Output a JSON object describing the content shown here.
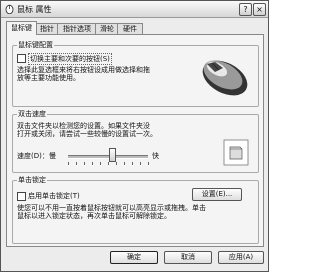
{
  "window": {
    "title": "鼠标 属性"
  },
  "titlebar_buttons": {
    "help": "?",
    "close": "×"
  },
  "tabs": [
    {
      "label": "鼠标键"
    },
    {
      "label": "指针"
    },
    {
      "label": "指针选项"
    },
    {
      "label": "滑轮"
    },
    {
      "label": "硬件"
    }
  ],
  "button_config": {
    "group_title": "鼠标键配置",
    "checkbox_label": "切换主要和次要的按钮(S)",
    "description_line1": "选择此复选框来将右按钮设成用做选择和拖",
    "description_line2": "放等主要功能使用。"
  },
  "double_click": {
    "group_title": "双击速度",
    "description_line1": "双击文件夹以检测您的设置。如果文件夹没",
    "description_line2": "打开或关闭，请尝试一些较慢的设置试一次。",
    "speed_label": "速度(D)：慢",
    "fast_label": "快",
    "speed_value": 0.55
  },
  "click_lock": {
    "group_title": "单击锁定",
    "checkbox_label": "启用单击锁定(T)",
    "settings_button": "设置(E)...",
    "description_line1": "使您可以不用一直按着鼠标按钮就可以高亮显示或拖拽。单击",
    "description_line2": "鼠标以进入锁定状态，再次单击鼠标可解除锁定。"
  },
  "footer": {
    "ok": "确定",
    "cancel": "取消",
    "apply": "应用(A)"
  }
}
